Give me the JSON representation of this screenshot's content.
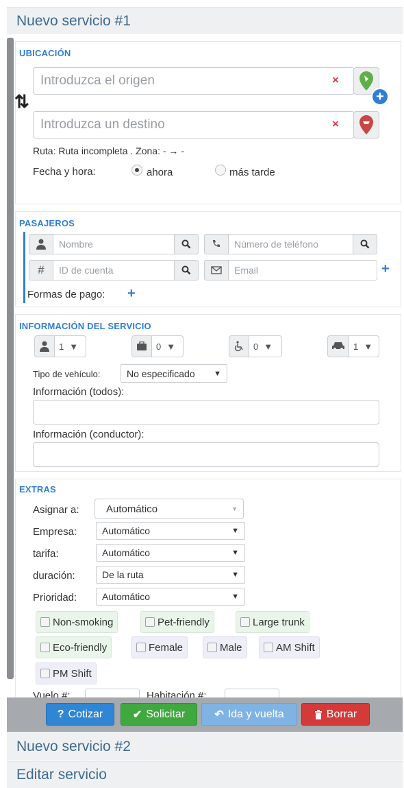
{
  "accordion": {
    "service1_title": "Nuevo servicio #1",
    "service2_title": "Nuevo servicio #2",
    "edit_title": "Editar servicio"
  },
  "location": {
    "title": "UBICACIÓN",
    "origin_placeholder": "Introduzca el origen",
    "destination_placeholder": "Introduzca un destino",
    "swap_icon": "⇅",
    "route_text": "Ruta: Ruta incompleta . Zona: - → -",
    "datetime_label": "Fecha y hora:",
    "now_label": "ahora",
    "later_label": "más tarde",
    "selected": "ahora"
  },
  "passengers": {
    "title": "PASAJEROS",
    "name_placeholder": "Nombre",
    "phone_placeholder": "Número de teléfono",
    "account_placeholder": "ID de cuenta",
    "email_placeholder": "Email",
    "payment_label": "Formas de pago:",
    "hash_symbol": "#"
  },
  "service_info": {
    "title": "INFORMACIÓN DEL SERVICIO",
    "passengers_count": "1",
    "luggage_count": "0",
    "wheelchair_count": "0",
    "vehicles_count": "1",
    "vehicle_type_label": "Tipo de vehículo:",
    "vehicle_type_value": "No especificado",
    "info_all_label": "Información (todos):",
    "info_driver_label": "Información (conductor):"
  },
  "extras": {
    "title": "EXTRAS",
    "assign_label": "Asignar a:",
    "assign_value": "Automático",
    "company_label": "Empresa:",
    "company_value": "Automático",
    "tariff_label": "tarifa:",
    "tariff_value": "Automático",
    "duration_label": "duración:",
    "duration_value": "De la ruta",
    "priority_label": "Prioridad:",
    "priority_value": "Automático",
    "chips": [
      "Non-smoking",
      "Pet-friendly",
      "Large trunk",
      "Eco-friendly",
      "Female",
      "Male",
      "AM Shift",
      "PM Shift"
    ],
    "flight_label": "Vuelo #:",
    "room_label": "Habitación #:"
  },
  "actions": {
    "quote_label": "Cotizar",
    "request_label": "Solicitar",
    "roundtrip_label": "Ida y vuelta",
    "delete_label": "Borrar"
  },
  "colors": {
    "accent": "#2f7fd3",
    "green": "#3fa83f",
    "red": "#d43a3a",
    "header_text": "#3e6a8f"
  }
}
